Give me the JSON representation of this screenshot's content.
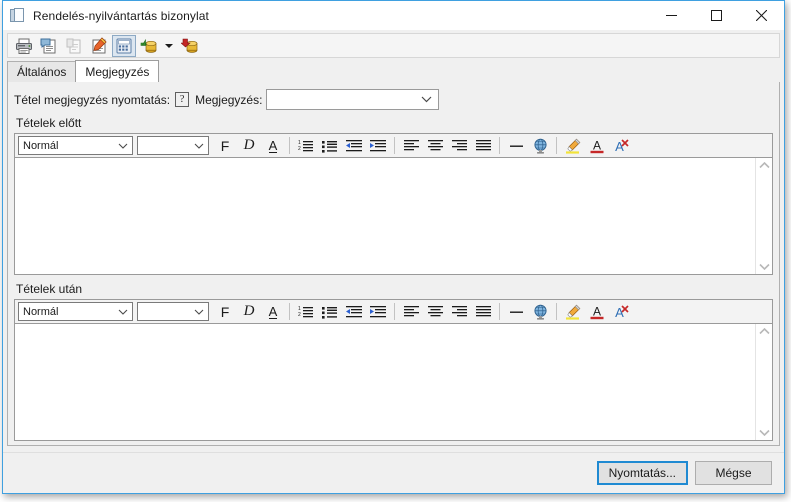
{
  "window": {
    "title": "Rendelés-nyilvántartás bizonylat",
    "title_icon": "document-pages-icon",
    "controls": {
      "minimize": "minimize-icon",
      "maximize": "maximize-icon",
      "close": "close-icon"
    },
    "accent_color": "#3fa0e0"
  },
  "toolbar": {
    "buttons": [
      {
        "name": "print-icon",
        "tooltip": "Nyomtatás",
        "state": "enabled"
      },
      {
        "name": "print-preview-icon",
        "tooltip": "Nyomtatási kép",
        "state": "enabled"
      },
      {
        "name": "copy-icon",
        "tooltip": "Másolás",
        "state": "disabled"
      },
      {
        "name": "edit-pencil-icon",
        "tooltip": "Szerkesztés",
        "state": "enabled"
      },
      {
        "name": "calculator-icon",
        "tooltip": "Számológép",
        "state": "pressed"
      },
      {
        "name": "money-in-icon",
        "tooltip": "Bevét",
        "state": "enabled"
      },
      {
        "name": "dropdown-arrow-icon",
        "tooltip": "További",
        "state": "enabled"
      },
      {
        "name": "money-out-icon",
        "tooltip": "Kiadás",
        "state": "enabled"
      }
    ]
  },
  "tabs": [
    {
      "label": "Általános",
      "active": false
    },
    {
      "label": "Megjegyzés",
      "active": true
    }
  ],
  "form": {
    "item_note_print_label": "Tétel megjegyzés nyomtatás:",
    "help_glyph": "?",
    "note_label": "Megjegyzés:",
    "note_value": "",
    "note_placeholder": ""
  },
  "sections": [
    {
      "label": "Tételek előtt",
      "editor": {
        "style_value": "Normál",
        "font_value": "",
        "content": "",
        "toolbar": [
          {
            "name": "bold-button",
            "glyph": "F"
          },
          {
            "name": "italic-button",
            "glyph": "D"
          },
          {
            "name": "underline-button",
            "glyph": "A"
          },
          {
            "name": "numbered-list-button",
            "glyph": "numbered-list-icon"
          },
          {
            "name": "bullet-list-button",
            "glyph": "bullet-list-icon"
          },
          {
            "name": "decrease-indent-button",
            "glyph": "decrease-indent-icon"
          },
          {
            "name": "increase-indent-button",
            "glyph": "increase-indent-icon"
          },
          {
            "name": "align-left-button",
            "glyph": "align-left-icon"
          },
          {
            "name": "align-center-button",
            "glyph": "align-center-icon"
          },
          {
            "name": "align-right-button",
            "glyph": "align-right-icon"
          },
          {
            "name": "align-justify-button",
            "glyph": "align-justify-icon"
          },
          {
            "name": "horizontal-rule-button",
            "glyph": "horizontal-rule-icon"
          },
          {
            "name": "hyperlink-button",
            "glyph": "globe-icon"
          },
          {
            "name": "highlight-button",
            "glyph": "highlighter-icon"
          },
          {
            "name": "font-color-button",
            "glyph": "A"
          },
          {
            "name": "clear-format-button",
            "glyph": "A"
          }
        ]
      }
    },
    {
      "label": "Tételek után",
      "editor": {
        "style_value": "Normál",
        "font_value": "",
        "content": "",
        "toolbar": [
          {
            "name": "bold-button",
            "glyph": "F"
          },
          {
            "name": "italic-button",
            "glyph": "D"
          },
          {
            "name": "underline-button",
            "glyph": "A"
          },
          {
            "name": "numbered-list-button",
            "glyph": "numbered-list-icon"
          },
          {
            "name": "bullet-list-button",
            "glyph": "bullet-list-icon"
          },
          {
            "name": "decrease-indent-button",
            "glyph": "decrease-indent-icon"
          },
          {
            "name": "increase-indent-button",
            "glyph": "increase-indent-icon"
          },
          {
            "name": "align-left-button",
            "glyph": "align-left-icon"
          },
          {
            "name": "align-center-button",
            "glyph": "align-center-icon"
          },
          {
            "name": "align-right-button",
            "glyph": "align-right-icon"
          },
          {
            "name": "align-justify-button",
            "glyph": "align-justify-icon"
          },
          {
            "name": "horizontal-rule-button",
            "glyph": "horizontal-rule-icon"
          },
          {
            "name": "hyperlink-button",
            "glyph": "globe-icon"
          },
          {
            "name": "highlight-button",
            "glyph": "highlighter-icon"
          },
          {
            "name": "font-color-button",
            "glyph": "A"
          },
          {
            "name": "clear-format-button",
            "glyph": "A"
          }
        ]
      }
    }
  ],
  "footer": {
    "print_label": "Nyomtatás...",
    "cancel_label": "Mégse"
  }
}
